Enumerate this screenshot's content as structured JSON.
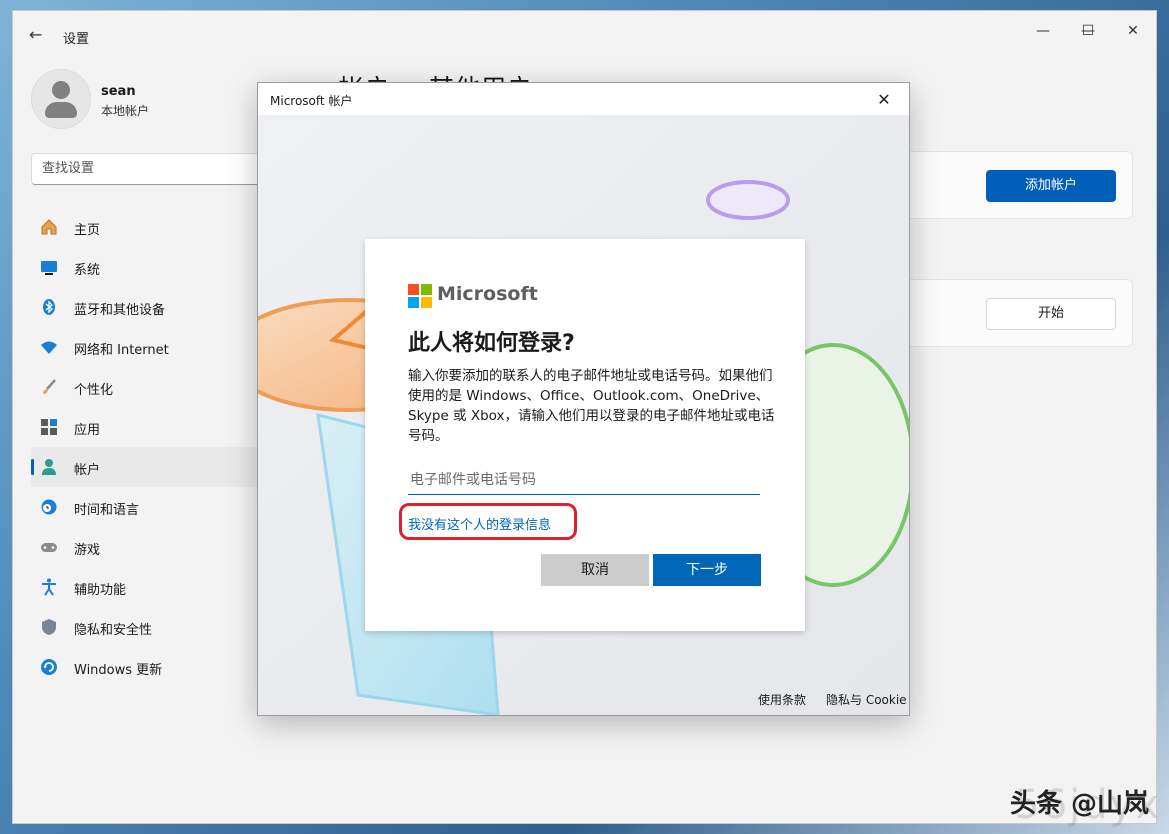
{
  "window": {
    "title": "设置",
    "controls": {
      "minimize": "—",
      "maximize": "☐",
      "close": "✕"
    }
  },
  "user": {
    "name": "sean",
    "account_type": "本地帐户"
  },
  "search": {
    "placeholder": "查找设置"
  },
  "sidebar": {
    "items": [
      {
        "label": "主页",
        "icon": "home-icon"
      },
      {
        "label": "系统",
        "icon": "system-icon"
      },
      {
        "label": "蓝牙和其他设备",
        "icon": "bluetooth-icon"
      },
      {
        "label": "网络和 Internet",
        "icon": "wifi-icon"
      },
      {
        "label": "个性化",
        "icon": "brush-icon"
      },
      {
        "label": "应用",
        "icon": "apps-icon"
      },
      {
        "label": "帐户",
        "icon": "account-icon",
        "active": true
      },
      {
        "label": "时间和语言",
        "icon": "clock-globe-icon"
      },
      {
        "label": "游戏",
        "icon": "gamepad-icon"
      },
      {
        "label": "辅助功能",
        "icon": "accessibility-icon"
      },
      {
        "label": "隐私和安全性",
        "icon": "shield-icon"
      },
      {
        "label": "Windows 更新",
        "icon": "update-icon"
      }
    ]
  },
  "main": {
    "heading": "帐户  >  其他用户",
    "add_account_button": "添加帐户",
    "start_button": "开始"
  },
  "dialog": {
    "title": "Microsoft 帐户",
    "close": "✕",
    "brand": "Microsoft",
    "heading": "此人将如何登录?",
    "description": "输入你要添加的联系人的电子邮件地址或电话号码。如果他们使用的是 Windows、Office、Outlook.com、OneDrive、Skype 或 Xbox，请输入他们用以登录的电子邮件地址或电话号码。",
    "email_placeholder": "电子邮件或电话号码",
    "email_value": "",
    "no_info_link": "我没有这个人的登录信息",
    "cancel_button": "取消",
    "next_button": "下一步",
    "footer_terms": "使用条款",
    "footer_privacy": "隐私与 Cookie"
  },
  "watermark": {
    "text": "头条 @山岚",
    "faint_text": "56jdyx"
  },
  "colors": {
    "accent": "#005fb8",
    "link": "#0067b8",
    "highlight": "#e0202b",
    "ms_red": "#f25022",
    "ms_green": "#7fba00",
    "ms_blue": "#00a4ef",
    "ms_yellow": "#ffb900"
  }
}
